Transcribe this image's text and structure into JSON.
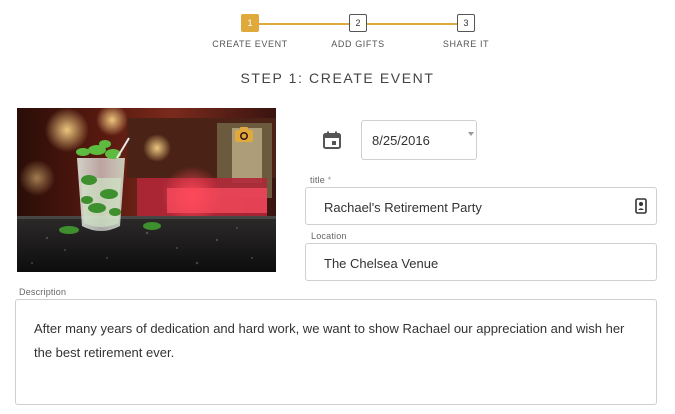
{
  "stepper": {
    "accent_color": "#e0a93b",
    "steps": [
      {
        "number": "1",
        "label": "CREATE EVENT",
        "state": "active"
      },
      {
        "number": "2",
        "label": "ADD GIFTS",
        "state": "inactive"
      },
      {
        "number": "3",
        "label": "SHARE IT",
        "state": "inactive"
      }
    ]
  },
  "page": {
    "heading": "STEP 1: CREATE EVENT"
  },
  "event_image": {
    "subject": "cocktail-on-bar-photo",
    "change_icon": "camera-icon"
  },
  "date": {
    "icon": "calendar-icon",
    "value": "8/25/2016"
  },
  "form": {
    "title": {
      "label": "title",
      "required_marker": "*",
      "value": "Rachael's Retirement Party",
      "icon": "contact-card-icon"
    },
    "location": {
      "label": "Location",
      "value": "The Chelsea Venue"
    },
    "description": {
      "label": "Description",
      "value": "After many years of dedication and hard work, we want to show Rachael our appreciation and wish her the best retirement ever."
    }
  }
}
